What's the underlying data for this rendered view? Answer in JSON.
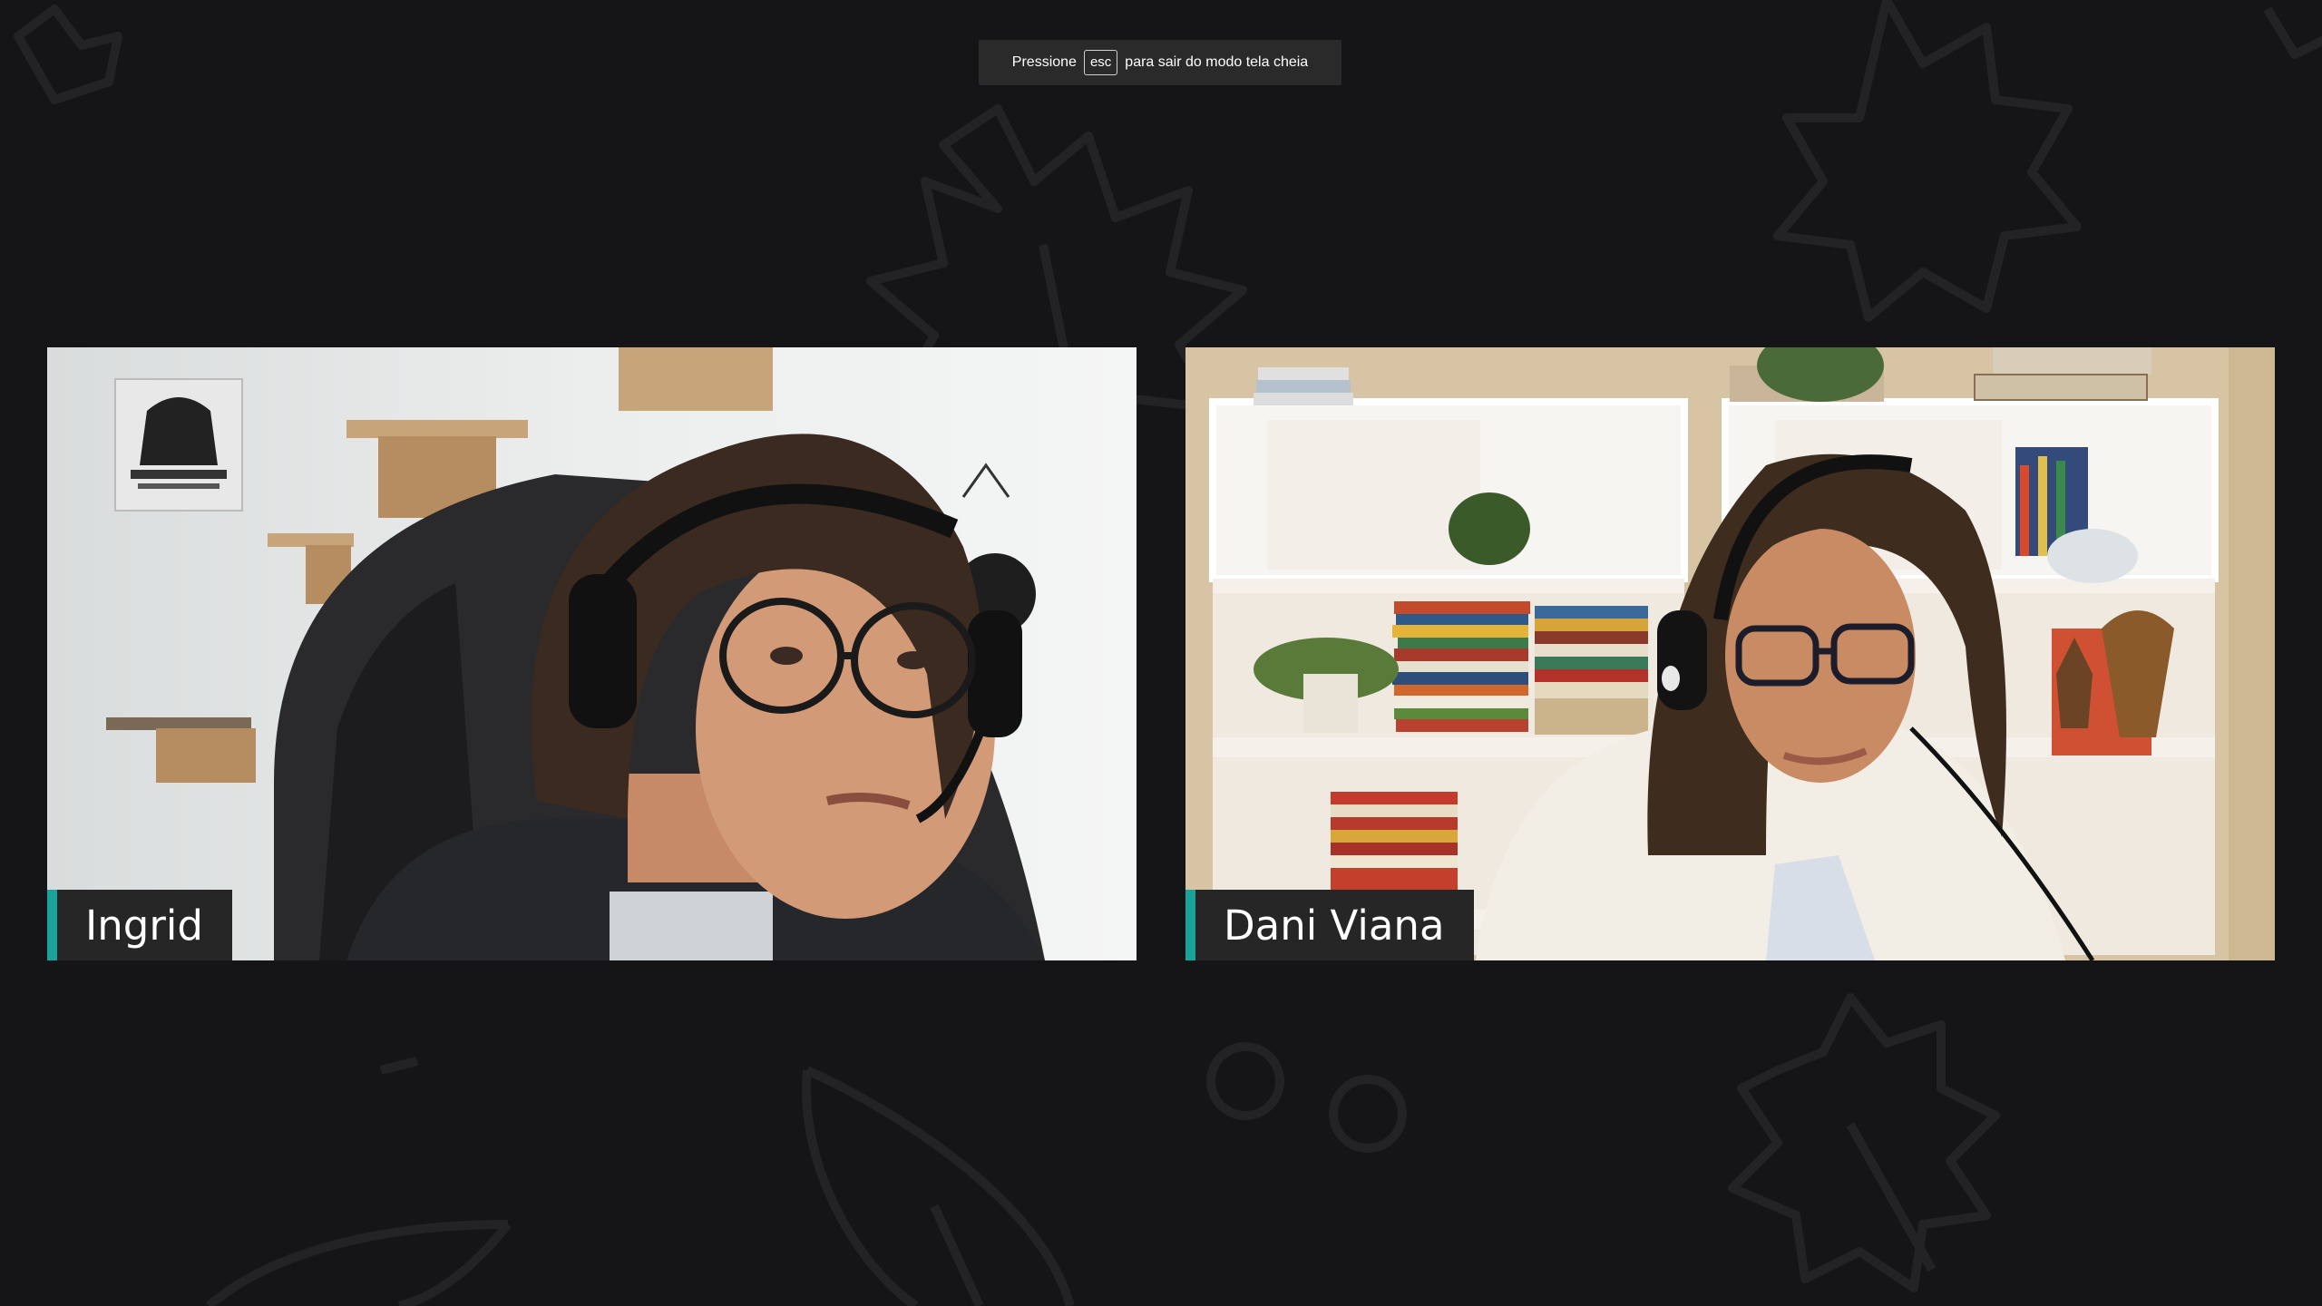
{
  "fullscreen_hint": {
    "prefix": "Pressione",
    "key": "esc",
    "suffix": "para sair do modo tela cheia"
  },
  "participants": [
    {
      "name": "Ingrid"
    },
    {
      "name": "Dani Viana"
    }
  ],
  "colors": {
    "background": "#151416",
    "nameplate": "#262626",
    "accent": "#1aa39a"
  }
}
